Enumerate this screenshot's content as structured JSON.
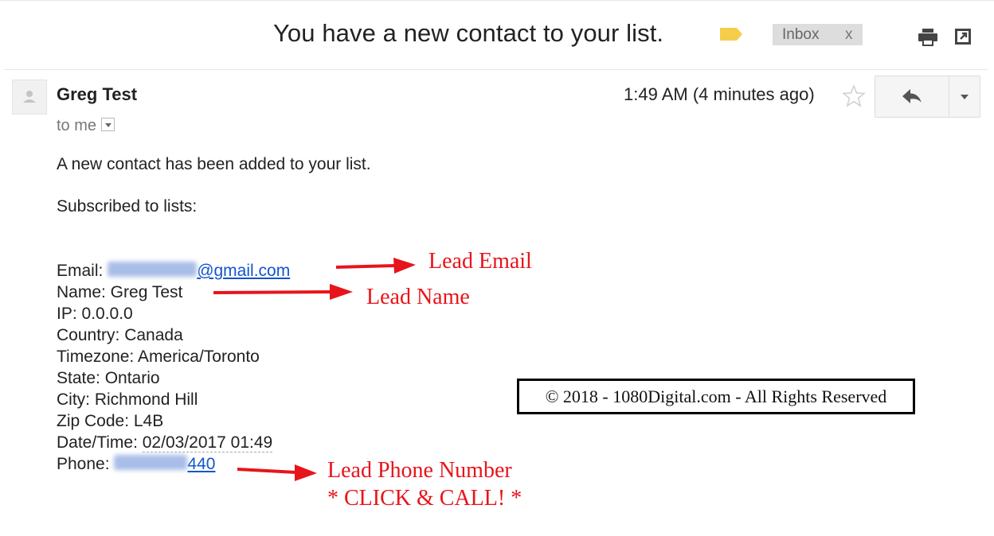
{
  "header": {
    "subject": "You have a new contact to your list.",
    "label_icon": "label-tag-icon",
    "label_color": "#f6cd4b",
    "inbox_chip": {
      "label": "Inbox",
      "remove": "x"
    },
    "actions": [
      "print-icon",
      "open-in-new-window-icon"
    ]
  },
  "message": {
    "sender": "Greg Test",
    "recipient": "to me",
    "time": "1:49 AM (4 minutes ago)",
    "starred": false,
    "body_line1": "A new contact has been added to your list.",
    "body_line2": "Subscribed to lists:",
    "fields": {
      "email_label": "Email: ",
      "email_hidden": "gregs2000",
      "email_domain": "@gmail.com",
      "name": "Name: Greg Test",
      "ip": "IP: 0.0.0.0",
      "country": "Country: Canada",
      "timezone": "Timezone: America/Toronto",
      "state": "State: Ontario",
      "city": "City: Richmond Hill",
      "zip": "Zip Code: L4B",
      "datetime_label": "Date/Time: ",
      "datetime_value": "02/03/2017 01:49",
      "phone_label": "Phone: ",
      "phone_hidden": "6475460",
      "phone_tail": "440"
    }
  },
  "annotations": {
    "lead_email": "Lead Email",
    "lead_name": "Lead Name",
    "lead_phone": "Lead Phone Number",
    "click_call": "* CLICK & CALL! *",
    "color": "#e8141b"
  },
  "copyright": "© 2018 - 1080Digital.com - All Rights Reserved"
}
